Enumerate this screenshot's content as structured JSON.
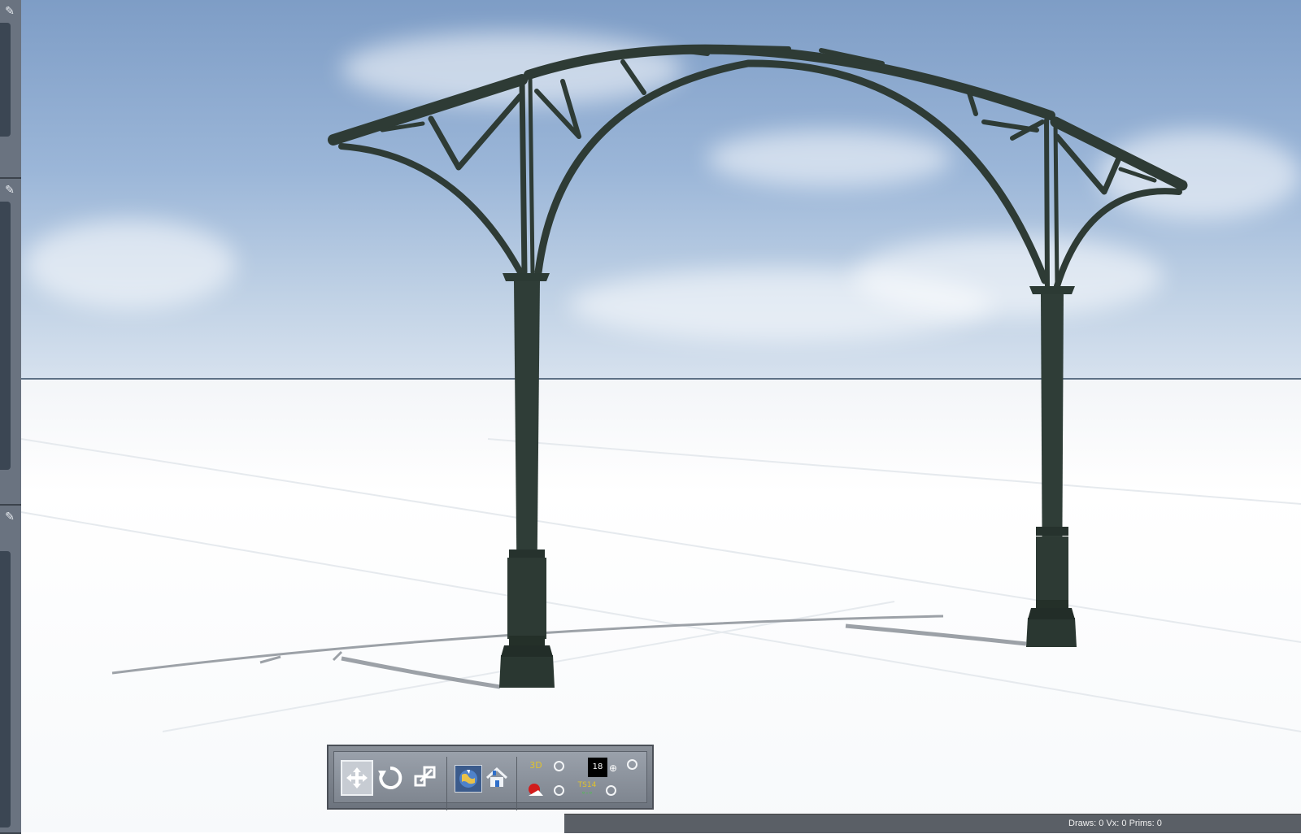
{
  "status_bar": {
    "stats": "Draws: 0 Vx: 0 Prims: 0"
  },
  "toolbar": {
    "counter_value": "18",
    "badge_3d_label": "3D",
    "badge_ts_label": "TS14"
  },
  "icons": {
    "dock_pin": "pin-icon",
    "move": "move-icon",
    "rotate": "rotate-icon",
    "scale": "resize-icon",
    "globe": "globe-icon",
    "home": "home-icon"
  },
  "colors": {
    "structure": "#2c3a34",
    "dock": "#5c6470",
    "toolbar": "#7f8690"
  }
}
